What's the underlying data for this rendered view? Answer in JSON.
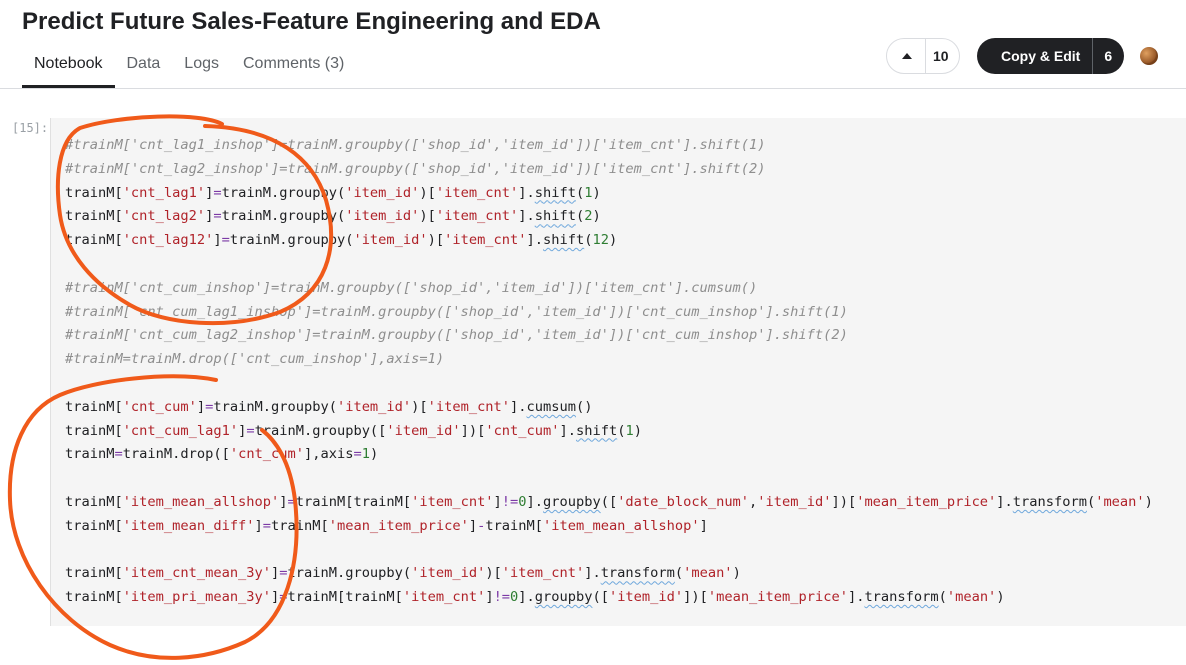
{
  "notebook": {
    "title": "Predict Future Sales-Feature Engineering and EDA"
  },
  "tabs": [
    {
      "label": "Notebook",
      "active": true
    },
    {
      "label": "Data",
      "active": false
    },
    {
      "label": "Logs",
      "active": false
    },
    {
      "label": "Comments (3)",
      "active": false
    }
  ],
  "toolbar": {
    "upvote_count": "10",
    "copy_edit_label": "Copy & Edit",
    "copy_count": "6"
  },
  "cell": {
    "execution_count": "[15]:"
  },
  "code_lines": [
    "#trainM['cnt_lag1_inshop']=trainM.groupby(['shop_id','item_id'])['item_cnt'].shift(1)",
    "#trainM['cnt_lag2_inshop']=trainM.groupby(['shop_id','item_id'])['item_cnt'].shift(2)",
    "trainM['cnt_lag1']=trainM.groupby('item_id')['item_cnt'].shift(1)",
    "trainM['cnt_lag2']=trainM.groupby('item_id')['item_cnt'].shift(2)",
    "trainM['cnt_lag12']=trainM.groupby('item_id')['item_cnt'].shift(12)",
    "",
    "#trainM['cnt_cum_inshop']=trainM.groupby(['shop_id','item_id'])['item_cnt'].cumsum()",
    "#trainM['cnt_cum_lag1_inshop']=trainM.groupby(['shop_id','item_id'])['cnt_cum_inshop'].shift(1)",
    "#trainM['cnt_cum_lag2_inshop']=trainM.groupby(['shop_id','item_id'])['cnt_cum_inshop'].shift(2)",
    "#trainM=trainM.drop(['cnt_cum_inshop'],axis=1)",
    "",
    "trainM['cnt_cum']=trainM.groupby('item_id')['item_cnt'].cumsum()",
    "trainM['cnt_cum_lag1']=trainM.groupby(['item_id'])['cnt_cum'].shift(1)",
    "trainM=trainM.drop(['cnt_cum'],axis=1)",
    "",
    "trainM['item_mean_allshop']=trainM[trainM['item_cnt']!=0].groupby(['date_block_num','item_id'])['mean_item_price'].transform('mean')",
    "trainM['item_mean_diff']=trainM['mean_item_price']-trainM['item_mean_allshop']",
    "",
    "trainM['item_cnt_mean_3y']=trainM.groupby('item_id')['item_cnt'].transform('mean')",
    "trainM['item_pri_mean_3y']=trainM[trainM['item_cnt']!=0].groupby(['item_id'])['mean_item_price'].transform('mean')"
  ],
  "colors": {
    "comment": "#8e8e8e",
    "string": "#b0232a",
    "operator": "#7c3aa6",
    "number": "#2e7d32",
    "annotation": "#f05a1a",
    "button_dark": "#202124"
  },
  "icons": [
    "upvote-arrow-icon",
    "avatar"
  ]
}
